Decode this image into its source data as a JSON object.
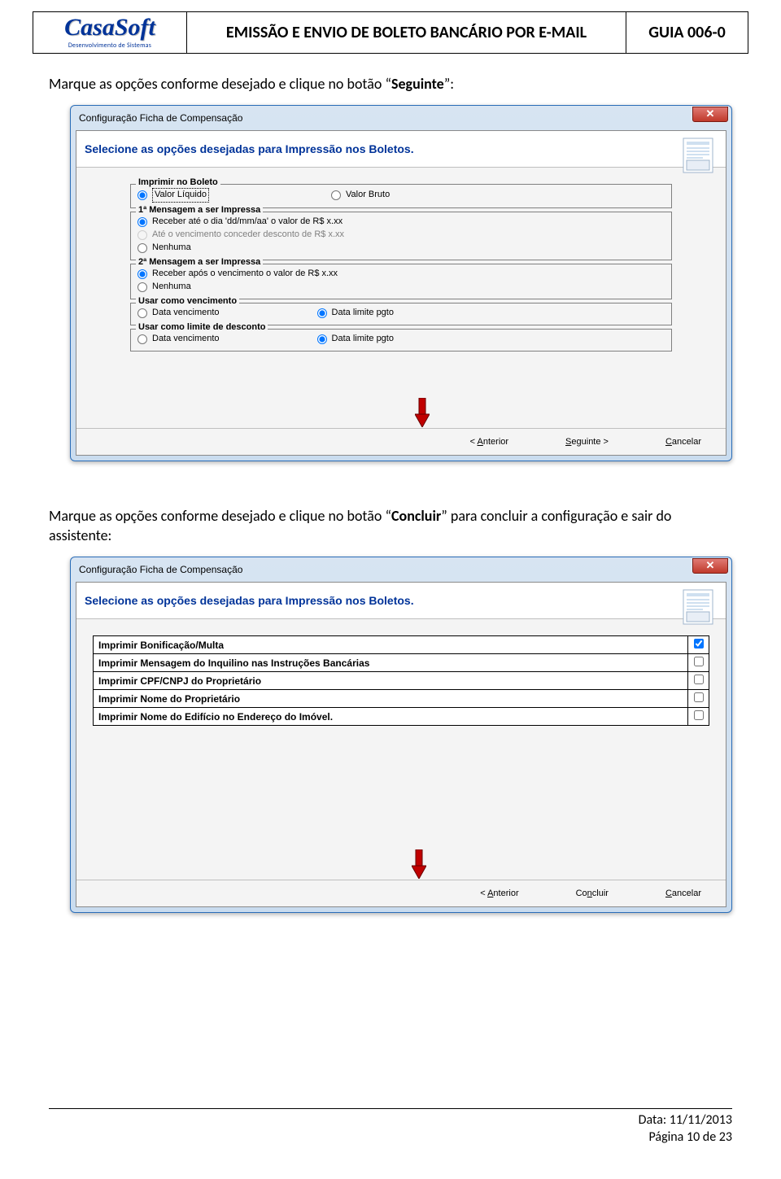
{
  "header": {
    "logo_main": "CasaSoft",
    "logo_sub": "Desenvolvimento de Sistemas",
    "title": "EMISSÃO E ENVIO DE BOLETO BANCÁRIO POR E-MAIL",
    "guide": "GUIA 006-0"
  },
  "instr1_pre": "Marque as opções conforme desejado e clique no botão ",
  "instr1_bold": "Seguinte",
  "instr1_post": ":",
  "instr2_pre": "Marque as opções conforme desejado e clique no botão ",
  "instr2_bold": "Concluir",
  "instr2_post": " para concluir a configuração e sair do assistente:",
  "dialog": {
    "title": "Configuração Ficha de Compensação",
    "heading": "Selecione as opções desejadas para Impressão nos Boletos.",
    "btn_prev": "< Anterior",
    "btn_next": "Seguinte >",
    "btn_finish": "Concluir",
    "btn_cancel": "Cancelar"
  },
  "groups": {
    "g1": {
      "legend": "Imprimir no Boleto",
      "opt1": "Valor Líquido",
      "opt2": "Valor Bruto"
    },
    "g2": {
      "legend": "1ª Mensagem a ser Impressa",
      "opt1": "Receber até o dia 'dd/mm/aa' o valor de  R$ x.xx",
      "opt2": "Até o vencimento conceder desconto de R$ x.xx",
      "opt3": "Nenhuma"
    },
    "g3": {
      "legend": "2ª Mensagem a ser Impressa",
      "opt1": "Receber após o vencimento o valor de R$ x.xx",
      "opt2": "Nenhuma"
    },
    "g4": {
      "legend": "Usar como vencimento",
      "opt1": "Data vencimento",
      "opt2": "Data limite pgto"
    },
    "g5": {
      "legend": "Usar como limite de desconto",
      "opt1": "Data vencimento",
      "opt2": "Data limite pgto"
    }
  },
  "checklist": [
    {
      "label": "Imprimir Bonificação/Multa",
      "checked": true
    },
    {
      "label": "Imprimir Mensagem do Inquilino nas Instruções Bancárias",
      "checked": false
    },
    {
      "label": "Imprimir CPF/CNPJ do Proprietário",
      "checked": false
    },
    {
      "label": "Imprimir Nome do Proprietário",
      "checked": false
    },
    {
      "label": "Imprimir Nome do Edifício no Endereço do Imóvel.",
      "checked": false
    }
  ],
  "footer": {
    "date": "Data: 11/11/2013",
    "page": "Página 10 de 23"
  }
}
